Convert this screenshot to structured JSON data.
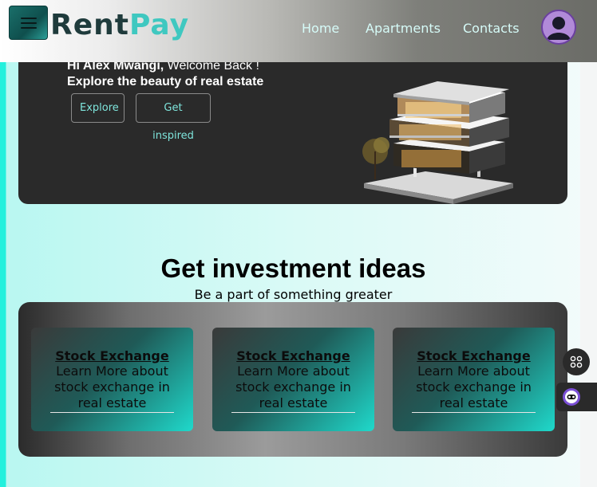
{
  "header": {
    "brand_part1": "Rent",
    "brand_part2": "Pay",
    "nav": {
      "home": "Home",
      "apartments": "Apartments",
      "contacts": "Contacts"
    }
  },
  "hero": {
    "greeting_name": "Hi Alex Mwangi,",
    "greeting_welcome": " Welcome Back !",
    "tagline": "Explore the beauty of real estate",
    "explore_label": "Explore",
    "inspired_label": "Get inspired"
  },
  "investment": {
    "title": "Get investment ideas",
    "subtitle": "Be a part of something greater",
    "cards": [
      {
        "title": "Stock Exchange",
        "description": "Learn More about stock exchange in real estate"
      },
      {
        "title": "Stock Exchange",
        "description": "Learn More about stock exchange in real estate"
      },
      {
        "title": "Stock Exchange",
        "description": "Learn More about stock exchange in real estate"
      }
    ]
  },
  "colors": {
    "accent": "#3fc8c0",
    "brand_dark": "#1f3b3c",
    "hero_bg": "#2a2a2a",
    "nav_text": "#d6fbf8",
    "card_gradient_end": "#1fd9cb"
  },
  "icons": {
    "menu": "hamburger-icon",
    "avatar": "user-avatar-icon",
    "house": "house-image",
    "widget": "grid-icon",
    "bot": "bot-icon"
  }
}
